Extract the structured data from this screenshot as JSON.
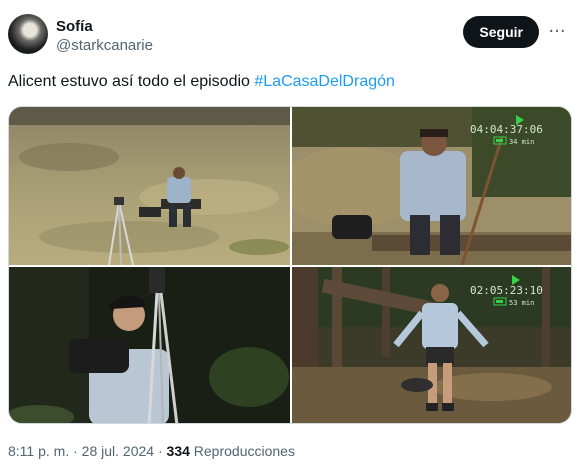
{
  "author": {
    "display_name": "Sofía",
    "handle": "@starkcanarie"
  },
  "actions": {
    "follow_label": "Seguir",
    "more_label": "···"
  },
  "tweet": {
    "text": "Alicent estuvo así todo el episodio ",
    "hashtag": "#LaCasaDelDragón"
  },
  "media": {
    "image2_timestamp": "04:04:37:06",
    "image2_battery": "34 min",
    "image4_timestamp": "02:05:23:10",
    "image4_battery": "53 min"
  },
  "meta": {
    "time": "8:11 p. m.",
    "separator1": " · ",
    "date": "28 jul. 2024",
    "separator2": " · ",
    "views_count": "334",
    "views_label": " Reproducciones"
  }
}
